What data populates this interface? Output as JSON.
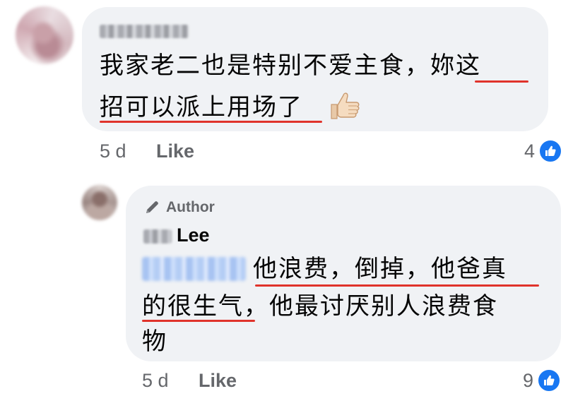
{
  "comment": {
    "text_line1": "我家老二也是特别不爱主食，妳这",
    "text_line2": "招可以派上用场了",
    "emoji": "thumbs-up",
    "time": "5 d",
    "like_label": "Like",
    "reaction_count": "4"
  },
  "reply": {
    "badge_label": "Author",
    "author_name": "Lee",
    "text_line1": "他浪费，倒掉，他爸真",
    "text_line2": "的很生气，他最讨厌别人浪费食",
    "text_line3": "物",
    "time": "5 d",
    "like_label": "Like",
    "reaction_count": "9"
  },
  "colors": {
    "bubble": "#f0f2f5",
    "meta_text": "#65676b",
    "like_blue": "#1877f2",
    "underline_red": "#e0332b"
  },
  "icons": [
    "pencil-icon",
    "like-reaction-icon",
    "thumbs-up-emoji"
  ]
}
